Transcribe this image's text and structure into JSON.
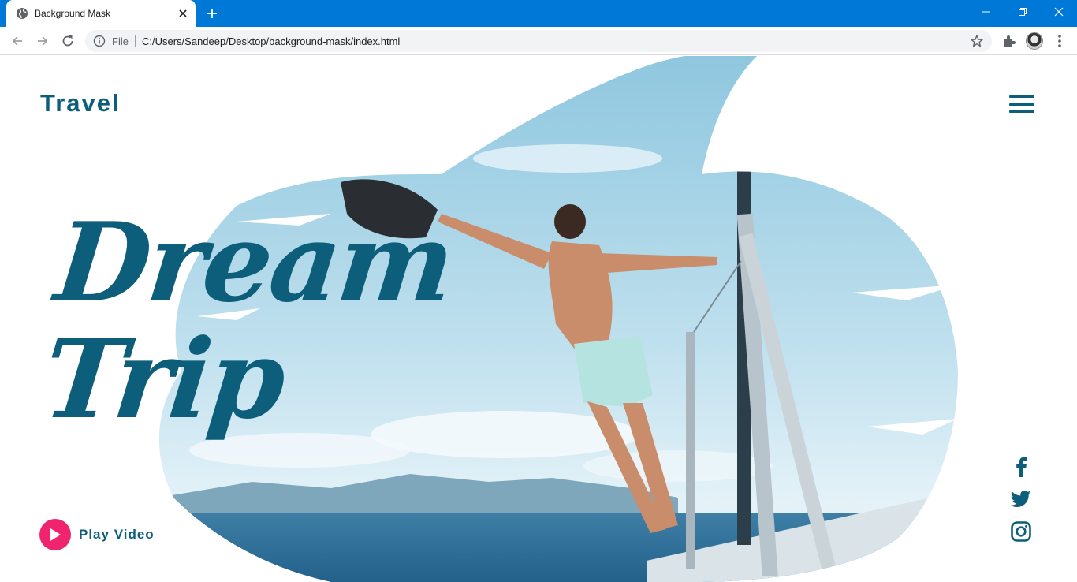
{
  "browser": {
    "tab_title": "Background Mask",
    "address_scheme": "File",
    "url": "C:/Users/Sandeep/Desktop/background-mask/index.html"
  },
  "page": {
    "brand": "Travel",
    "headline_line1": "Dream",
    "headline_line2": "Trip",
    "play_video_label": "Play Video",
    "social_icons": [
      "facebook-icon",
      "twitter-icon",
      "instagram-icon"
    ]
  },
  "colors": {
    "tabbar": "#0078d7",
    "brand": "#0d5e7a",
    "play_button": "#f0246e"
  }
}
